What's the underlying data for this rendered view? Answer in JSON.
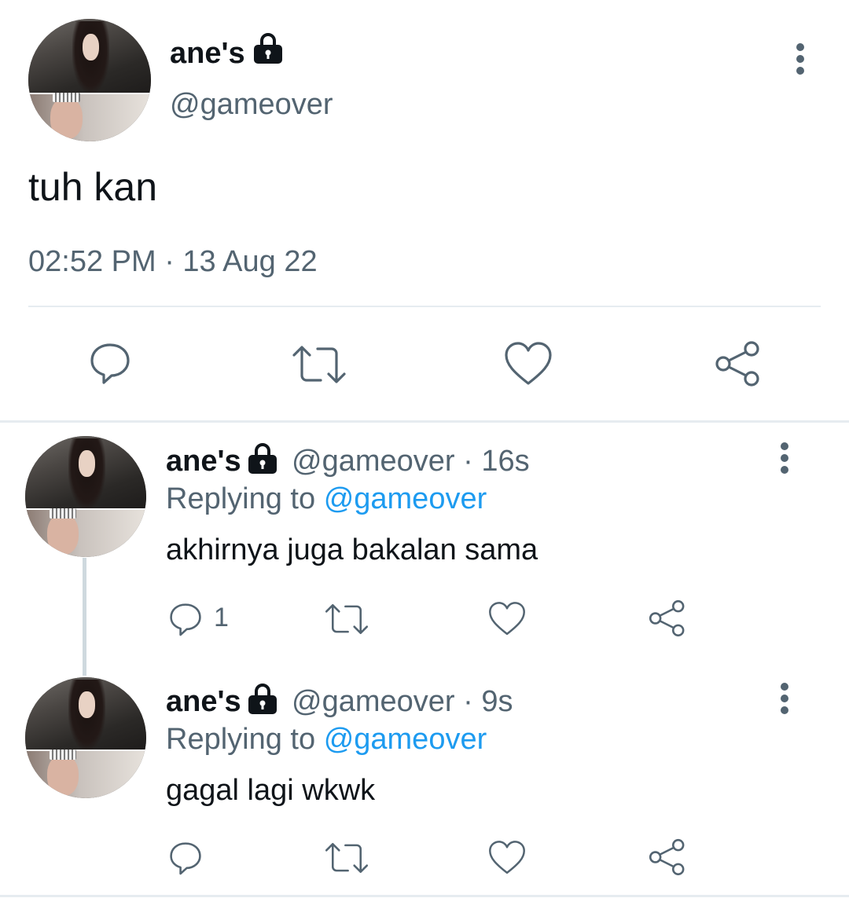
{
  "main_tweet": {
    "display_name": "ane's",
    "handle": "@gameover",
    "text": "tuh kan",
    "timestamp": "02:52 PM · 13 Aug 22"
  },
  "replies": [
    {
      "display_name": "ane's",
      "handle_time": "@gameover · 16s",
      "replying_prefix": "Replying to",
      "replying_handle": "@gameover",
      "text": "akhirnya juga bakalan sama",
      "reply_count": "1"
    },
    {
      "display_name": "ane's",
      "handle_time": "@gameover · 9s",
      "replying_prefix": "Replying to",
      "replying_handle": "@gameover",
      "text": "gagal lagi wkwk",
      "reply_count": ""
    }
  ],
  "icons": {
    "lock": "lock-icon",
    "more": "more-vertical-icon",
    "reply": "reply-icon",
    "retweet": "retweet-icon",
    "like": "like-icon",
    "share": "share-icon"
  },
  "colors": {
    "text": "#0f1419",
    "secondary": "#536471",
    "link": "#1d9bf0",
    "divider": "#e6ecf0",
    "thread_line": "#cfd9de"
  }
}
